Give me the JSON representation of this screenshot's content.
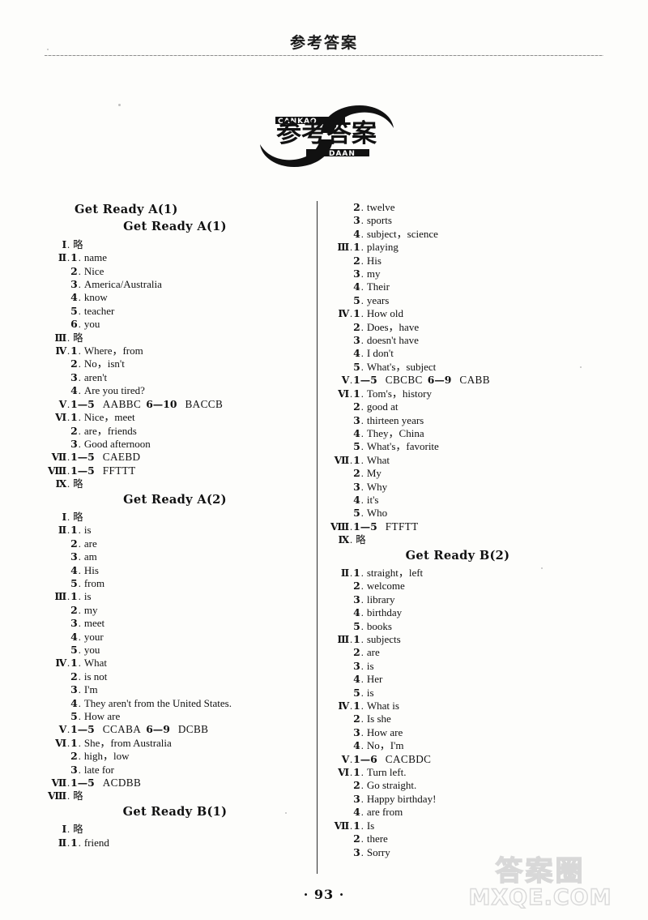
{
  "header": {
    "running_title": "参考答案"
  },
  "logo": {
    "cjk": "参考答案",
    "pinyin_top": "CANKAO",
    "pinyin_bottom": "DAAN"
  },
  "footer": {
    "page_number": "· 93 ·"
  },
  "watermark": {
    "cjk": "答案圈",
    "url": "MXQE.COM"
  },
  "left_column": [
    {
      "type": "title",
      "level": 1,
      "text": "Get Ready A(1)"
    },
    {
      "type": "title",
      "level": 2,
      "text": "Get Ready A(1)"
    },
    {
      "type": "row",
      "rn": "Ⅰ",
      "num": "",
      "text": "略",
      "cjk": true
    },
    {
      "type": "row",
      "rn": "Ⅱ",
      "num": "1",
      "text": "name"
    },
    {
      "type": "row",
      "rn": "",
      "num": "2",
      "text": "Nice"
    },
    {
      "type": "row",
      "rn": "",
      "num": "3",
      "text": "America/Australia"
    },
    {
      "type": "row",
      "rn": "",
      "num": "4",
      "text": "know"
    },
    {
      "type": "row",
      "rn": "",
      "num": "5",
      "text": "teacher"
    },
    {
      "type": "row",
      "rn": "",
      "num": "6",
      "text": "you"
    },
    {
      "type": "row",
      "rn": "Ⅲ",
      "num": "",
      "text": "略",
      "cjk": true
    },
    {
      "type": "row",
      "rn": "Ⅳ",
      "num": "1",
      "text": "Where，from"
    },
    {
      "type": "row",
      "rn": "",
      "num": "2",
      "text": "No，isn't"
    },
    {
      "type": "row",
      "rn": "",
      "num": "3",
      "text": "aren't"
    },
    {
      "type": "row",
      "rn": "",
      "num": "4",
      "text": "Are you tired?"
    },
    {
      "type": "range",
      "rn": "Ⅴ",
      "ranges": [
        {
          "span": "1—5",
          "letters": "AABBC"
        },
        {
          "span": "6—10",
          "letters": "BACCB"
        }
      ]
    },
    {
      "type": "row",
      "rn": "Ⅵ",
      "num": "1",
      "text": "Nice，meet"
    },
    {
      "type": "row",
      "rn": "",
      "num": "2",
      "text": "are，friends"
    },
    {
      "type": "row",
      "rn": "",
      "num": "3",
      "text": "Good afternoon"
    },
    {
      "type": "range",
      "rn": "Ⅶ",
      "ranges": [
        {
          "span": "1—5",
          "letters": "CAEBD"
        }
      ]
    },
    {
      "type": "range",
      "rn": "Ⅷ",
      "ranges": [
        {
          "span": "1—5",
          "letters": "FFTTT"
        }
      ]
    },
    {
      "type": "row",
      "rn": "Ⅸ",
      "num": "",
      "text": "略",
      "cjk": true
    },
    {
      "type": "title",
      "level": 2,
      "text": "Get Ready A(2)"
    },
    {
      "type": "row",
      "rn": "Ⅰ",
      "num": "",
      "text": "略",
      "cjk": true
    },
    {
      "type": "row",
      "rn": "Ⅱ",
      "num": "1",
      "text": "is"
    },
    {
      "type": "row",
      "rn": "",
      "num": "2",
      "text": "are"
    },
    {
      "type": "row",
      "rn": "",
      "num": "3",
      "text": "am"
    },
    {
      "type": "row",
      "rn": "",
      "num": "4",
      "text": "His"
    },
    {
      "type": "row",
      "rn": "",
      "num": "5",
      "text": "from"
    },
    {
      "type": "row",
      "rn": "Ⅲ",
      "num": "1",
      "text": "is"
    },
    {
      "type": "row",
      "rn": "",
      "num": "2",
      "text": "my"
    },
    {
      "type": "row",
      "rn": "",
      "num": "3",
      "text": "meet"
    },
    {
      "type": "row",
      "rn": "",
      "num": "4",
      "text": "your"
    },
    {
      "type": "row",
      "rn": "",
      "num": "5",
      "text": "you"
    },
    {
      "type": "row",
      "rn": "Ⅳ",
      "num": "1",
      "text": "What"
    },
    {
      "type": "row",
      "rn": "",
      "num": "2",
      "text": "is not"
    },
    {
      "type": "row",
      "rn": "",
      "num": "3",
      "text": "I'm"
    },
    {
      "type": "row",
      "rn": "",
      "num": "4",
      "text": "They aren't from the United States."
    },
    {
      "type": "row",
      "rn": "",
      "num": "5",
      "text": "How are"
    },
    {
      "type": "range",
      "rn": "Ⅴ",
      "ranges": [
        {
          "span": "1—5",
          "letters": "CCABA"
        },
        {
          "span": "6—9",
          "letters": "DCBB"
        }
      ]
    },
    {
      "type": "row",
      "rn": "Ⅵ",
      "num": "1",
      "text": "She，from Australia"
    },
    {
      "type": "row",
      "rn": "",
      "num": "2",
      "text": "high，low"
    },
    {
      "type": "row",
      "rn": "",
      "num": "3",
      "text": "late for"
    },
    {
      "type": "range",
      "rn": "Ⅶ",
      "ranges": [
        {
          "span": "1—5",
          "letters": "ACDBB"
        }
      ]
    },
    {
      "type": "row",
      "rn": "Ⅷ",
      "num": "",
      "text": "略",
      "cjk": true
    },
    {
      "type": "title",
      "level": 2,
      "text": "Get Ready B(1)"
    },
    {
      "type": "row",
      "rn": "Ⅰ",
      "num": "",
      "text": "略",
      "cjk": true
    },
    {
      "type": "row",
      "rn": "Ⅱ",
      "num": "1",
      "text": "friend"
    }
  ],
  "right_column": [
    {
      "type": "row",
      "rn": "",
      "num": "2",
      "text": "twelve"
    },
    {
      "type": "row",
      "rn": "",
      "num": "3",
      "text": "sports"
    },
    {
      "type": "row",
      "rn": "",
      "num": "4",
      "text": "subject，science"
    },
    {
      "type": "row",
      "rn": "Ⅲ",
      "num": "1",
      "text": "playing"
    },
    {
      "type": "row",
      "rn": "",
      "num": "2",
      "text": "His"
    },
    {
      "type": "row",
      "rn": "",
      "num": "3",
      "text": "my"
    },
    {
      "type": "row",
      "rn": "",
      "num": "4",
      "text": "Their"
    },
    {
      "type": "row",
      "rn": "",
      "num": "5",
      "text": "years"
    },
    {
      "type": "row",
      "rn": "Ⅳ",
      "num": "1",
      "text": "How old"
    },
    {
      "type": "row",
      "rn": "",
      "num": "2",
      "text": "Does，have"
    },
    {
      "type": "row",
      "rn": "",
      "num": "3",
      "text": "doesn't have"
    },
    {
      "type": "row",
      "rn": "",
      "num": "4",
      "text": "I don't"
    },
    {
      "type": "row",
      "rn": "",
      "num": "5",
      "text": "What's，subject"
    },
    {
      "type": "range",
      "rn": "Ⅴ",
      "ranges": [
        {
          "span": "1—5",
          "letters": "CBCBC"
        },
        {
          "span": "6—9",
          "letters": "CABB"
        }
      ]
    },
    {
      "type": "row",
      "rn": "Ⅵ",
      "num": "1",
      "text": "Tom's，history"
    },
    {
      "type": "row",
      "rn": "",
      "num": "2",
      "text": "good at"
    },
    {
      "type": "row",
      "rn": "",
      "num": "3",
      "text": "thirteen years"
    },
    {
      "type": "row",
      "rn": "",
      "num": "4",
      "text": "They，China"
    },
    {
      "type": "row",
      "rn": "",
      "num": "5",
      "text": "What's，favorite"
    },
    {
      "type": "row",
      "rn": "Ⅶ",
      "num": "1",
      "text": "What"
    },
    {
      "type": "row",
      "rn": "",
      "num": "2",
      "text": "My"
    },
    {
      "type": "row",
      "rn": "",
      "num": "3",
      "text": "Why"
    },
    {
      "type": "row",
      "rn": "",
      "num": "4",
      "text": "it's"
    },
    {
      "type": "row",
      "rn": "",
      "num": "5",
      "text": "Who"
    },
    {
      "type": "range",
      "rn": "Ⅷ",
      "ranges": [
        {
          "span": "1—5",
          "letters": "FTFTT"
        }
      ]
    },
    {
      "type": "row",
      "rn": "Ⅸ",
      "num": "",
      "text": "略",
      "cjk": true
    },
    {
      "type": "title",
      "level": 2,
      "text": "Get Ready B(2)"
    },
    {
      "type": "row",
      "rn": "Ⅱ",
      "num": "1",
      "text": "straight，left"
    },
    {
      "type": "row",
      "rn": "",
      "num": "2",
      "text": "welcome"
    },
    {
      "type": "row",
      "rn": "",
      "num": "3",
      "text": "library"
    },
    {
      "type": "row",
      "rn": "",
      "num": "4",
      "text": "birthday"
    },
    {
      "type": "row",
      "rn": "",
      "num": "5",
      "text": "books"
    },
    {
      "type": "row",
      "rn": "Ⅲ",
      "num": "1",
      "text": "subjects"
    },
    {
      "type": "row",
      "rn": "",
      "num": "2",
      "text": "are"
    },
    {
      "type": "row",
      "rn": "",
      "num": "3",
      "text": "is"
    },
    {
      "type": "row",
      "rn": "",
      "num": "4",
      "text": "Her"
    },
    {
      "type": "row",
      "rn": "",
      "num": "5",
      "text": "is"
    },
    {
      "type": "row",
      "rn": "Ⅳ",
      "num": "1",
      "text": "What is"
    },
    {
      "type": "row",
      "rn": "",
      "num": "2",
      "text": "Is she"
    },
    {
      "type": "row",
      "rn": "",
      "num": "3",
      "text": "How are"
    },
    {
      "type": "row",
      "rn": "",
      "num": "4",
      "text": "No，I'm"
    },
    {
      "type": "range",
      "rn": "Ⅴ",
      "ranges": [
        {
          "span": "1—6",
          "letters": "CACBDC"
        }
      ]
    },
    {
      "type": "row",
      "rn": "Ⅵ",
      "num": "1",
      "text": "Turn left."
    },
    {
      "type": "row",
      "rn": "",
      "num": "2",
      "text": "Go straight."
    },
    {
      "type": "row",
      "rn": "",
      "num": "3",
      "text": "Happy birthday!"
    },
    {
      "type": "row",
      "rn": "",
      "num": "4",
      "text": "are from"
    },
    {
      "type": "row",
      "rn": "Ⅶ",
      "num": "1",
      "text": "Is"
    },
    {
      "type": "row",
      "rn": "",
      "num": "2",
      "text": "there"
    },
    {
      "type": "row",
      "rn": "",
      "num": "3",
      "text": "Sorry"
    }
  ]
}
